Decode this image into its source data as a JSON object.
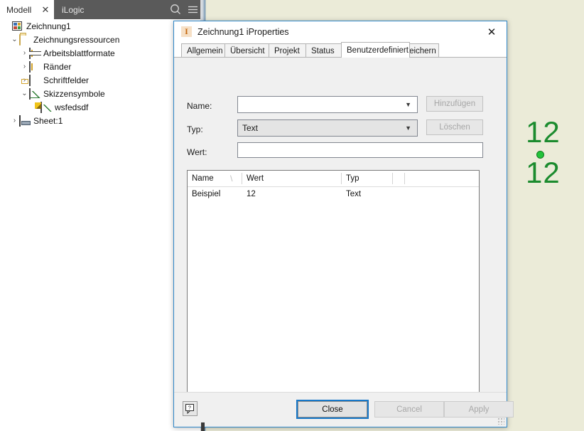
{
  "browser_panel": {
    "tabs": [
      {
        "label": "Modell",
        "active": true,
        "close_icon": "close-icon"
      },
      {
        "label": "iLogic",
        "active": false
      }
    ],
    "search_icon": "search-icon",
    "menu_icon": "hamburger-menu-icon",
    "tree": [
      {
        "label": "Zeichnung1",
        "depth": 0,
        "chevron": "",
        "icon": "drawing-document-icon"
      },
      {
        "label": "Zeichnungsressourcen",
        "depth": 1,
        "chevron": "expanded",
        "icon": "folder-icon"
      },
      {
        "label": "Arbeitsblattformate",
        "depth": 2,
        "chevron": "collapsed",
        "icon": "sheet-format-icon"
      },
      {
        "label": "Ränder",
        "depth": 2,
        "chevron": "collapsed",
        "icon": "border-icon"
      },
      {
        "label": "Schriftfelder",
        "depth": 2,
        "chevron": "collapsed",
        "icon": "title-block-icon"
      },
      {
        "label": "Skizzensymbole",
        "depth": 2,
        "chevron": "expanded",
        "icon": "sketched-symbol-icon"
      },
      {
        "label": "wsfedsdf",
        "depth": 3,
        "chevron": "",
        "icon": "sketched-symbol-edit-icon"
      },
      {
        "label": "Sheet:1",
        "depth": 1,
        "chevron": "collapsed",
        "icon": "sheet-icon"
      }
    ]
  },
  "dialog": {
    "icon": "iproperties-icon",
    "title": "Zeichnung1 iProperties",
    "close_icon": "close-icon",
    "tabs": [
      {
        "label": "Allgemein",
        "selected": false
      },
      {
        "label": "Übersicht",
        "selected": false
      },
      {
        "label": "Projekt",
        "selected": false
      },
      {
        "label": "Status",
        "selected": false
      },
      {
        "label": "Benutzerdefiniert",
        "selected": true
      },
      {
        "label": "Speichern",
        "selected": false
      }
    ],
    "form": {
      "name_label": "Name:",
      "name_value": "",
      "name_placeholder": "",
      "type_label": "Typ:",
      "type_value": "Text",
      "value_label": "Wert:",
      "value_value": "",
      "value_placeholder": "",
      "add_button": "Hinzufügen",
      "delete_button": "Löschen",
      "dropdown_icon": "chevron-down-icon"
    },
    "list": {
      "columns": [
        "Name",
        "Wert",
        "Typ",
        "",
        ""
      ],
      "sort_indicator": "sort-ascending-icon",
      "rows": [
        {
          "name": "Beispiel",
          "value": "12",
          "type": "Text"
        }
      ]
    },
    "footer": {
      "help_label": "?",
      "help_icon": "help-question-icon",
      "close_button": "Close",
      "cancel_button": "Cancel",
      "apply_button": "Apply",
      "resize_grip_icon": "resize-grip-icon"
    }
  },
  "canvas": {
    "background_color": "#e9e9d7",
    "marks": [
      {
        "text": "12",
        "color": "#1b8b2e"
      },
      {
        "text": "12",
        "color": "#1b8b2e"
      }
    ],
    "point_color": "#22c33a",
    "point_icon": "sketch-point-icon"
  }
}
